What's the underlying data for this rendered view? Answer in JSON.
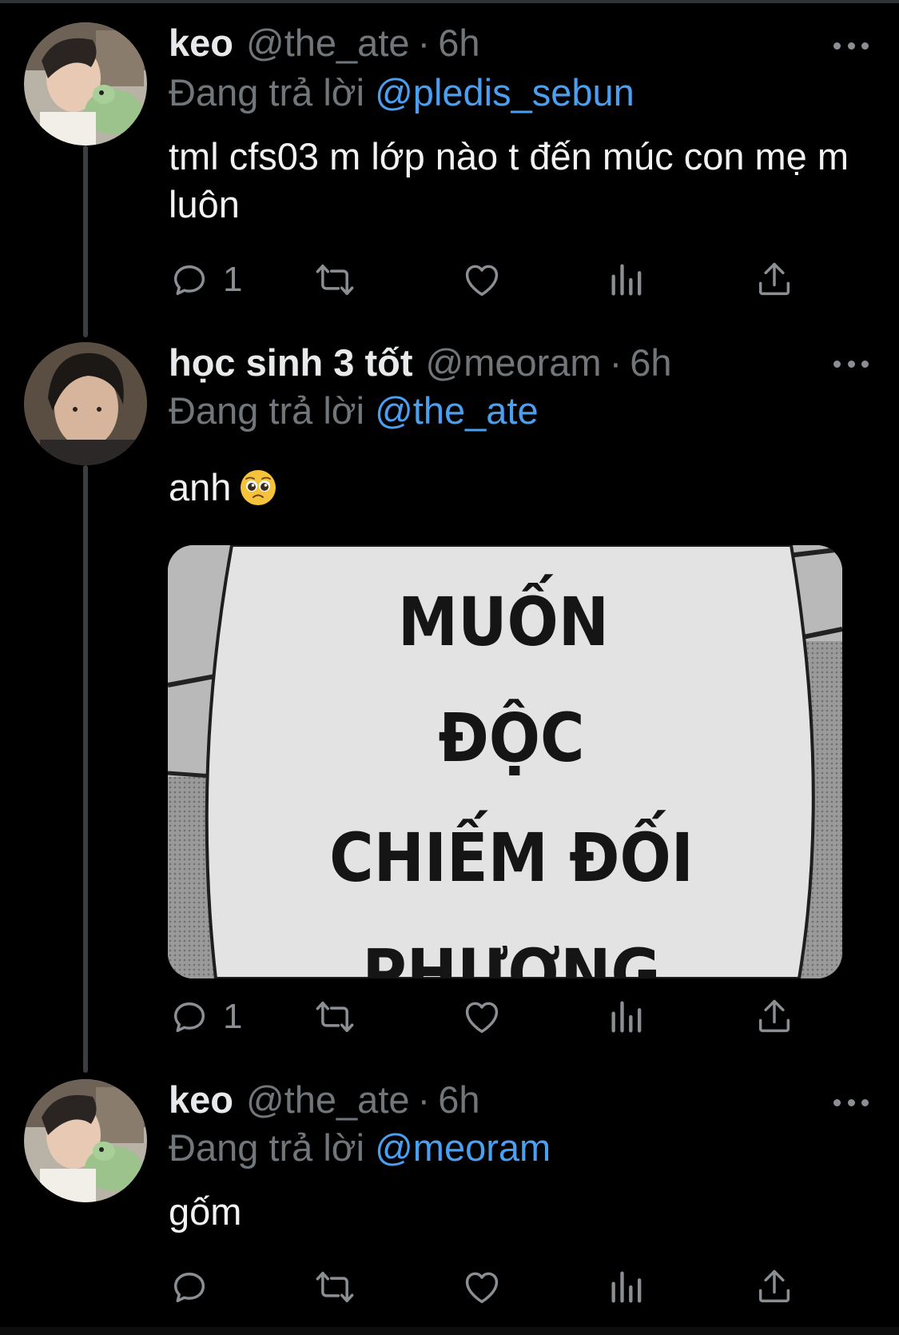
{
  "tweets": [
    {
      "display_name": "keo",
      "handle": "@the_ate",
      "separator": "·",
      "time": "6h",
      "reply_prefix": "Đang trả lời",
      "reply_to": "@pledis_sebun",
      "text": "tml cfs03 m lớp nào t đến múc con mẹ m luôn",
      "reply_count": "1",
      "avatar_icon": "avatar-keo"
    },
    {
      "display_name": "học sinh 3 tốt",
      "handle": "@meoram",
      "separator": "·",
      "time": "6h",
      "reply_prefix": "Đang trả lời",
      "reply_to": "@the_ate",
      "text": "anh",
      "emoji": "pleading-face-icon",
      "reply_count": "1",
      "avatar_icon": "avatar-meoram",
      "media": {
        "lines": [
          "MUỐN",
          "ĐỘC",
          "CHIẾM ĐỐI",
          "PHƯƠNG"
        ]
      }
    },
    {
      "display_name": "keo",
      "handle": "@the_ate",
      "separator": "·",
      "time": "6h",
      "reply_prefix": "Đang trả lời",
      "reply_to": "@meoram",
      "text": "gốm",
      "reply_count": "",
      "avatar_icon": "avatar-keo"
    }
  ],
  "icons": {
    "reply": "reply-icon",
    "retweet": "retweet-icon",
    "like": "heart-icon",
    "views": "views-icon",
    "share": "share-icon",
    "more": "more-icon"
  },
  "colors": {
    "background": "#000000",
    "mention": "#4a9ff0",
    "muted": "#71767b",
    "text": "#e7e9ea"
  }
}
